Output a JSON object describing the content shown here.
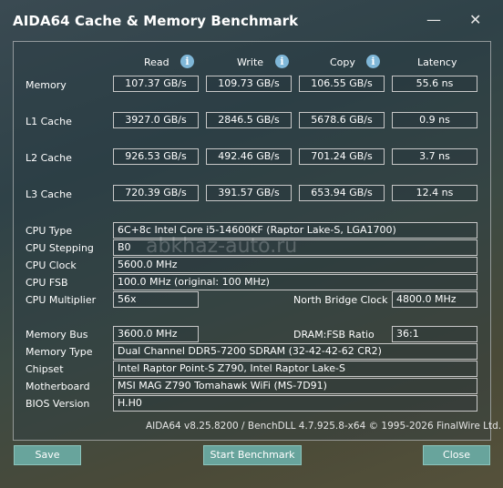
{
  "window": {
    "title": "AIDA64 Cache & Memory Benchmark",
    "min_glyph": "—",
    "close_glyph": "✕"
  },
  "watermark": "abkhaz-auto.ru",
  "columns": {
    "read": "Read",
    "write": "Write",
    "copy": "Copy",
    "latency": "Latency",
    "info_glyph": "i"
  },
  "bench": {
    "memory": {
      "label": "Memory",
      "read": "107.37 GB/s",
      "write": "109.73 GB/s",
      "copy": "106.55 GB/s",
      "latency": "55.6 ns"
    },
    "l1": {
      "label": "L1 Cache",
      "read": "3927.0 GB/s",
      "write": "2846.5 GB/s",
      "copy": "5678.6 GB/s",
      "latency": "0.9 ns"
    },
    "l2": {
      "label": "L2 Cache",
      "read": "926.53 GB/s",
      "write": "492.46 GB/s",
      "copy": "701.24 GB/s",
      "latency": "3.7 ns"
    },
    "l3": {
      "label": "L3 Cache",
      "read": "720.39 GB/s",
      "write": "391.57 GB/s",
      "copy": "653.94 GB/s",
      "latency": "12.4 ns"
    }
  },
  "cpu": {
    "type_label": "CPU Type",
    "type": "6C+8c Intel Core i5-14600KF  (Raptor Lake-S, LGA1700)",
    "stepping_label": "CPU Stepping",
    "stepping": "B0",
    "clock_label": "CPU Clock",
    "clock": "5600.0 MHz",
    "fsb_label": "CPU FSB",
    "fsb": "100.0 MHz  (original: 100 MHz)",
    "multiplier_label": "CPU Multiplier",
    "multiplier": "56x",
    "nb_clock_label": "North Bridge Clock",
    "nb_clock": "4800.0 MHz"
  },
  "mem": {
    "bus_label": "Memory Bus",
    "bus": "3600.0 MHz",
    "ratio_label": "DRAM:FSB Ratio",
    "ratio": "36:1",
    "type_label": "Memory Type",
    "type": "Dual Channel DDR5-7200 SDRAM  (32-42-42-62 CR2)",
    "chipset_label": "Chipset",
    "chipset": "Intel Raptor Point-S Z790, Intel Raptor Lake-S",
    "motherboard_label": "Motherboard",
    "motherboard": "MSI MAG Z790 Tomahawk WiFi (MS-7D91)",
    "bios_label": "BIOS Version",
    "bios": "H.H0"
  },
  "footer": "AIDA64 v8.25.8200 / BenchDLL 4.7.925.8-x64 © 1995-2026 FinalWire Ltd.",
  "buttons": {
    "save": "Save",
    "start": "Start Benchmark",
    "close": "Close"
  }
}
